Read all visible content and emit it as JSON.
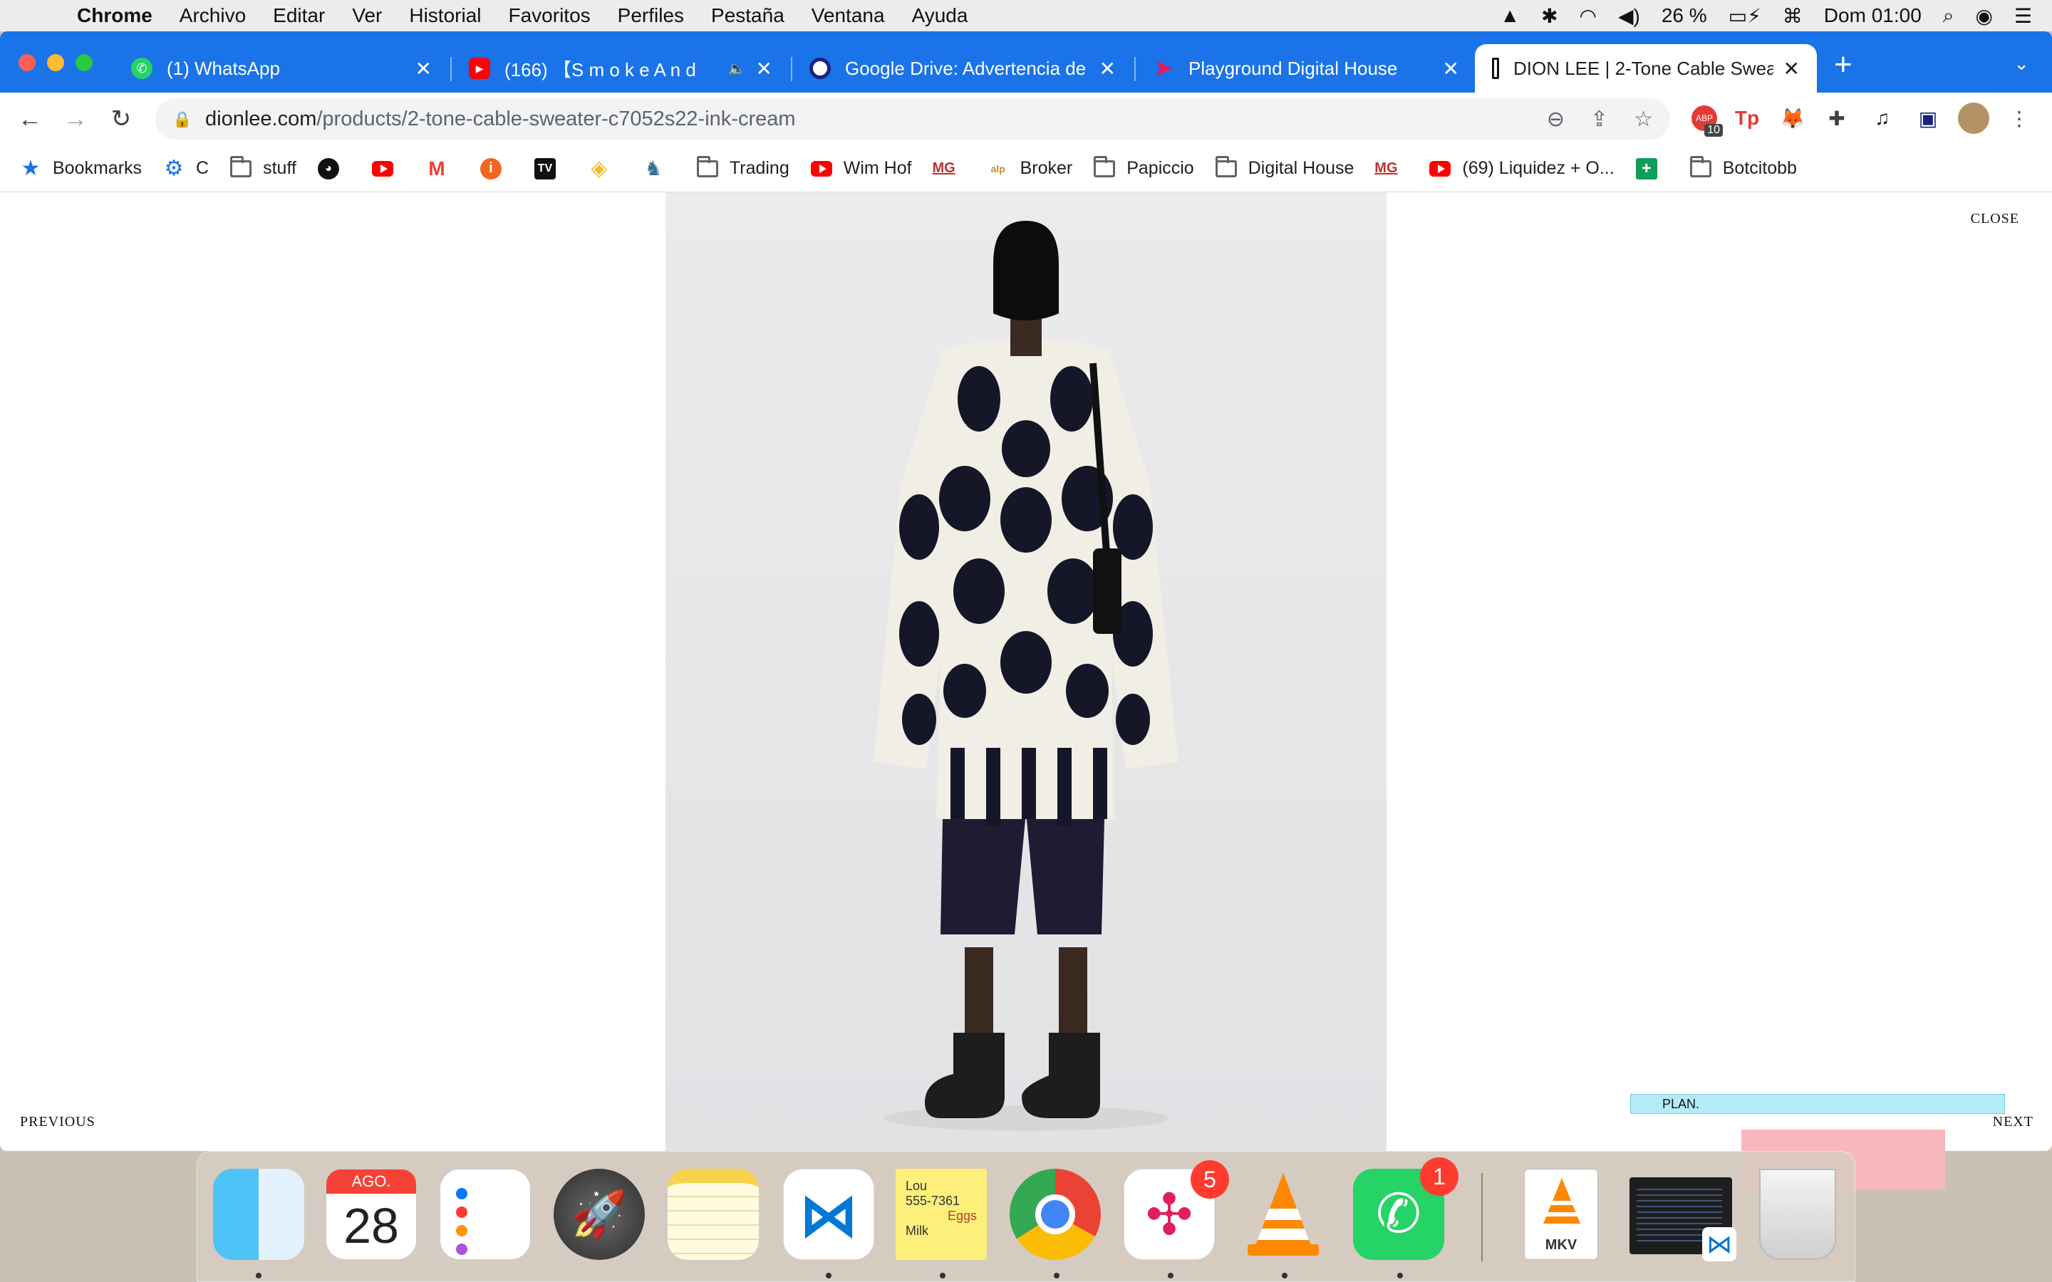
{
  "menubar": {
    "app_name": "Chrome",
    "items": [
      "Archivo",
      "Editar",
      "Ver",
      "Historial",
      "Favoritos",
      "Perfiles",
      "Pestaña",
      "Ventana",
      "Ayuda"
    ],
    "battery": "26 %",
    "clock": "Dom 01:00"
  },
  "tabs": [
    {
      "title": "(1) WhatsApp"
    },
    {
      "title": "(166) 【S m o k e   A n d"
    },
    {
      "title": "Google Drive: Advertencia de a"
    },
    {
      "title": "Playground Digital House"
    },
    {
      "title": "DION LEE | 2-Tone Cable Swea"
    }
  ],
  "address": {
    "domain": "dionlee.com",
    "path": "/products/2-tone-cable-sweater-c7052s22-ink-cream"
  },
  "extensions": {
    "abp_count": "10"
  },
  "bookmarks": [
    {
      "label": "Bookmarks",
      "icon": "star-icon"
    },
    {
      "label": "C",
      "icon": "gear-icon"
    },
    {
      "label": "stuff",
      "icon": "folder-icon"
    },
    {
      "label": "",
      "icon": "github-icon"
    },
    {
      "label": "",
      "icon": "youtube-icon"
    },
    {
      "label": "",
      "icon": "gmail-icon"
    },
    {
      "label": "",
      "icon": "orange-circle-icon"
    },
    {
      "label": "",
      "icon": "tradingview-icon"
    },
    {
      "label": "",
      "icon": "binance-icon"
    },
    {
      "label": "",
      "icon": "horse-icon"
    },
    {
      "label": "Trading",
      "icon": "folder-icon"
    },
    {
      "label": "Wim Hof",
      "icon": "youtube-icon"
    },
    {
      "label": "",
      "icon": "mg-icon"
    },
    {
      "label": "Broker",
      "icon": "alpari-icon"
    },
    {
      "label": "Papiccio",
      "icon": "folder-icon"
    },
    {
      "label": "Digital House",
      "icon": "folder-icon"
    },
    {
      "label": "",
      "icon": "mg-icon"
    },
    {
      "label": "(69) Liquidez + O...",
      "icon": "youtube-icon"
    },
    {
      "label": "",
      "icon": "sheets-icon"
    },
    {
      "label": "Botcitobb",
      "icon": "folder-icon"
    }
  ],
  "page": {
    "close": "CLOSE",
    "previous": "PREVIOUS",
    "next": "NEXT",
    "plan": "PLAN."
  },
  "dock": {
    "calendar_month": "AGO.",
    "calendar_day": "28",
    "slack_badge": "5",
    "whatsapp_badge": "1",
    "mkv_label": "MKV",
    "stickies_lines": [
      "Lou",
      "555-7361",
      "Eggs",
      "Milk"
    ]
  },
  "colors": {
    "tabstrip": "#1a73e8",
    "plan_bar": "#b5eaf7",
    "badge": "#ff3b30"
  }
}
